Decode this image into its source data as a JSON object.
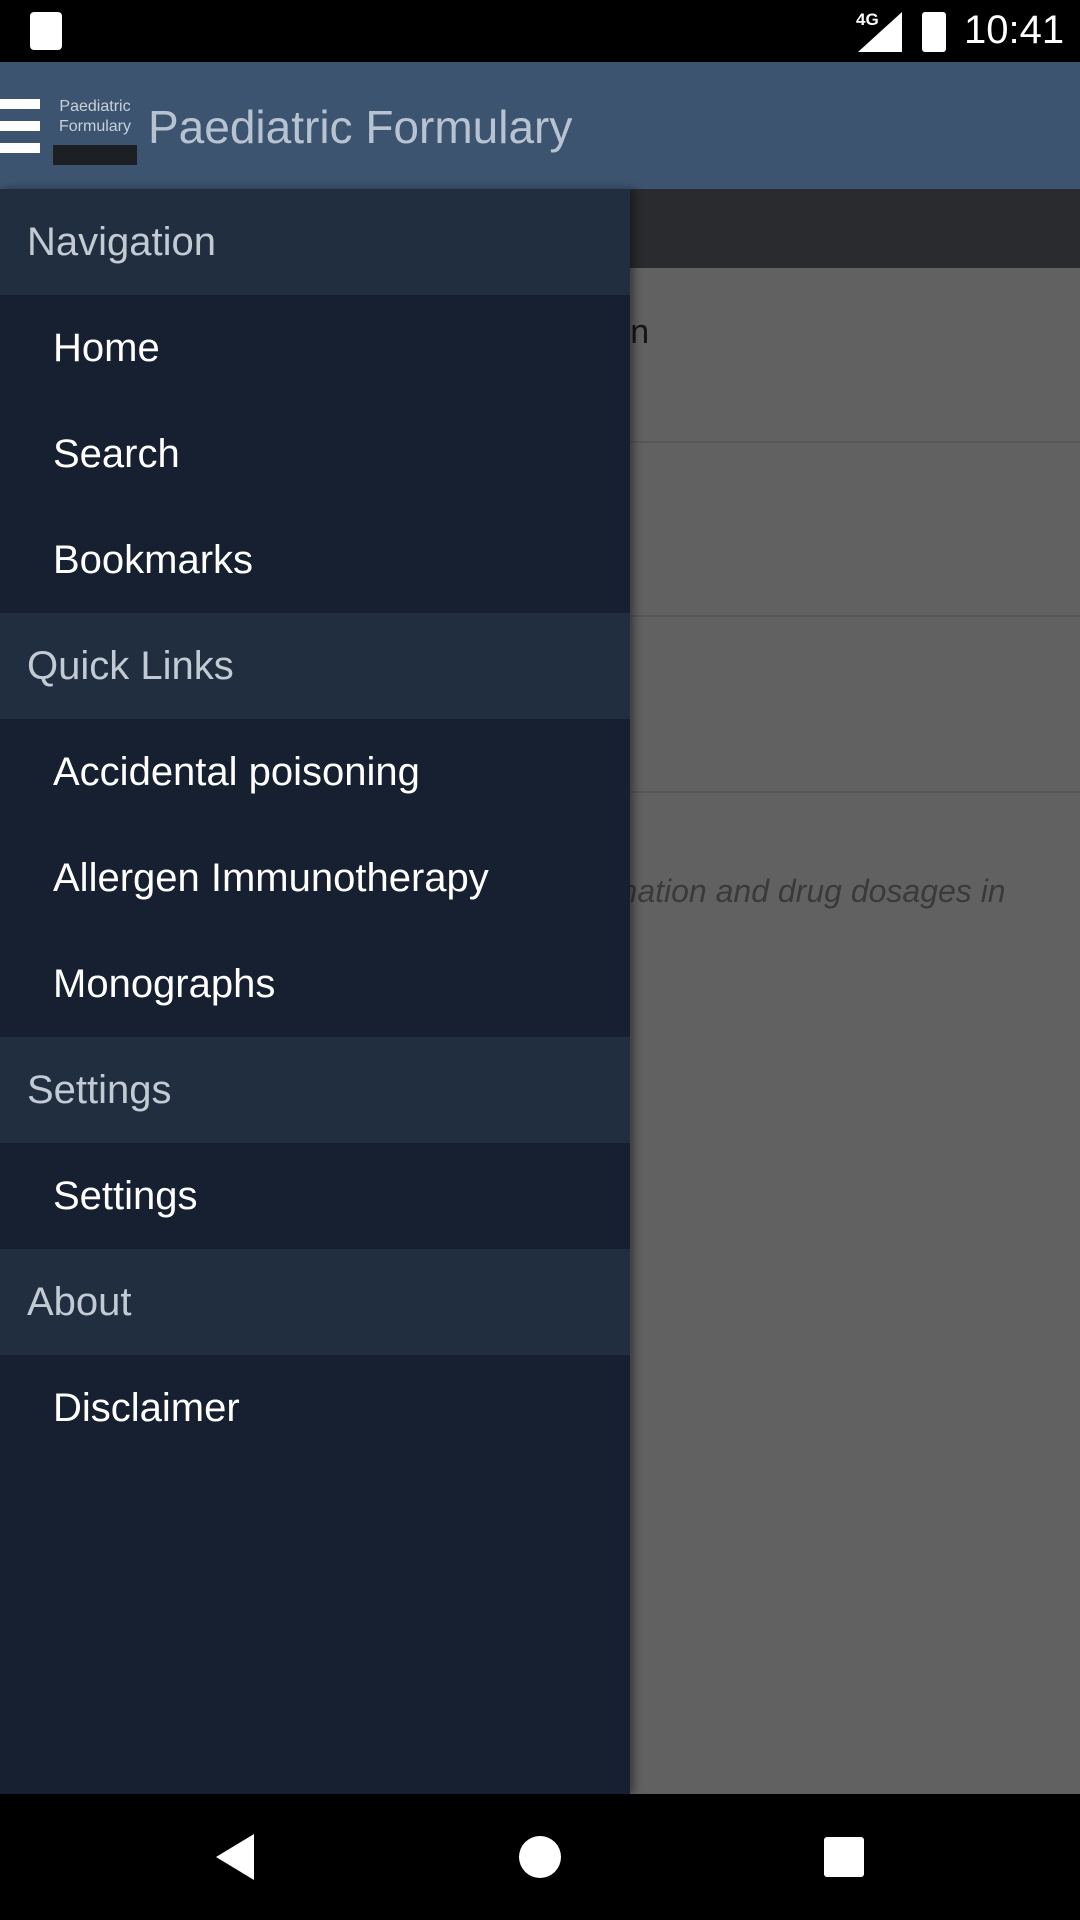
{
  "status_bar": {
    "network": "4G",
    "time": "10:41"
  },
  "app_bar": {
    "logo_text": "Paediatric Formulary",
    "title": "Paediatric Formulary"
  },
  "background_content": {
    "fragment_1": "ren",
    "fragment_2": "rmation and drug dosages in"
  },
  "drawer": {
    "sections": [
      {
        "header": "Navigation",
        "items": [
          "Home",
          "Search",
          "Bookmarks"
        ]
      },
      {
        "header": "Quick Links",
        "items": [
          "Accidental poisoning",
          "Allergen Immunotherapy",
          "Monographs"
        ]
      },
      {
        "header": "Settings",
        "items": [
          "Settings"
        ]
      },
      {
        "header": "About",
        "items": [
          "Disclaimer"
        ]
      }
    ]
  },
  "colors": {
    "app_bar": "#3d5470",
    "drawer_bg": "#172030",
    "section_header_bg": "#202e40"
  }
}
